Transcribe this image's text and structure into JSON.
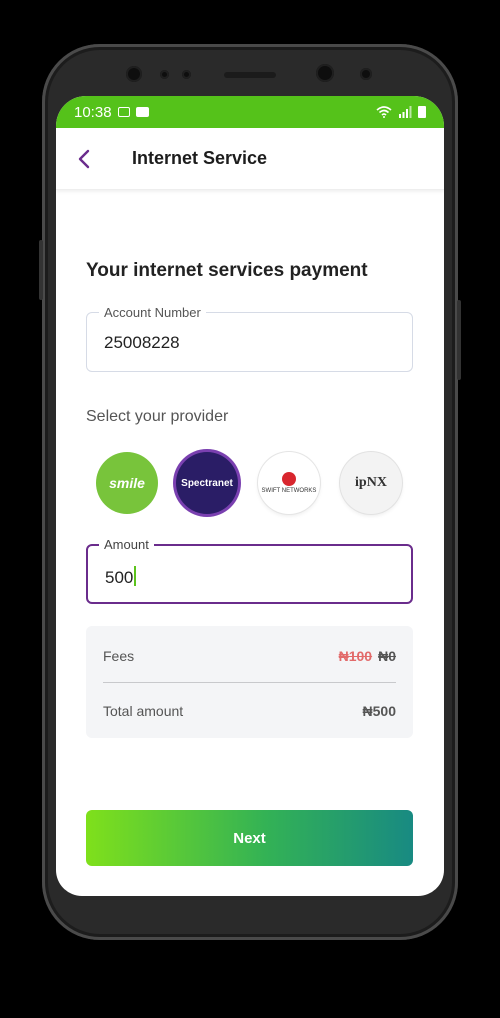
{
  "status_bar": {
    "time": "10:38"
  },
  "app_bar": {
    "title": "Internet Service"
  },
  "form": {
    "heading": "Your internet services payment",
    "account": {
      "label": "Account Number",
      "value": "25008228"
    },
    "provider_prompt": "Select your provider",
    "providers": [
      {
        "name": "smile",
        "selected": false
      },
      {
        "name": "Spectranet",
        "selected": true
      },
      {
        "name": "SWIFT NETWORKS",
        "selected": false
      },
      {
        "name": "ipNX",
        "selected": false
      }
    ],
    "amount": {
      "label": "Amount",
      "value": "500"
    }
  },
  "summary": {
    "fees_label": "Fees",
    "fees_old": "₦100",
    "fees_new": "₦0",
    "total_label": "Total amount",
    "total_value": "₦500"
  },
  "actions": {
    "next_label": "Next"
  },
  "colors": {
    "status_green": "#55c21a",
    "brand_purple": "#6a2c8c",
    "button_gradient_start": "#7fe01b",
    "button_gradient_end": "#188a82"
  }
}
